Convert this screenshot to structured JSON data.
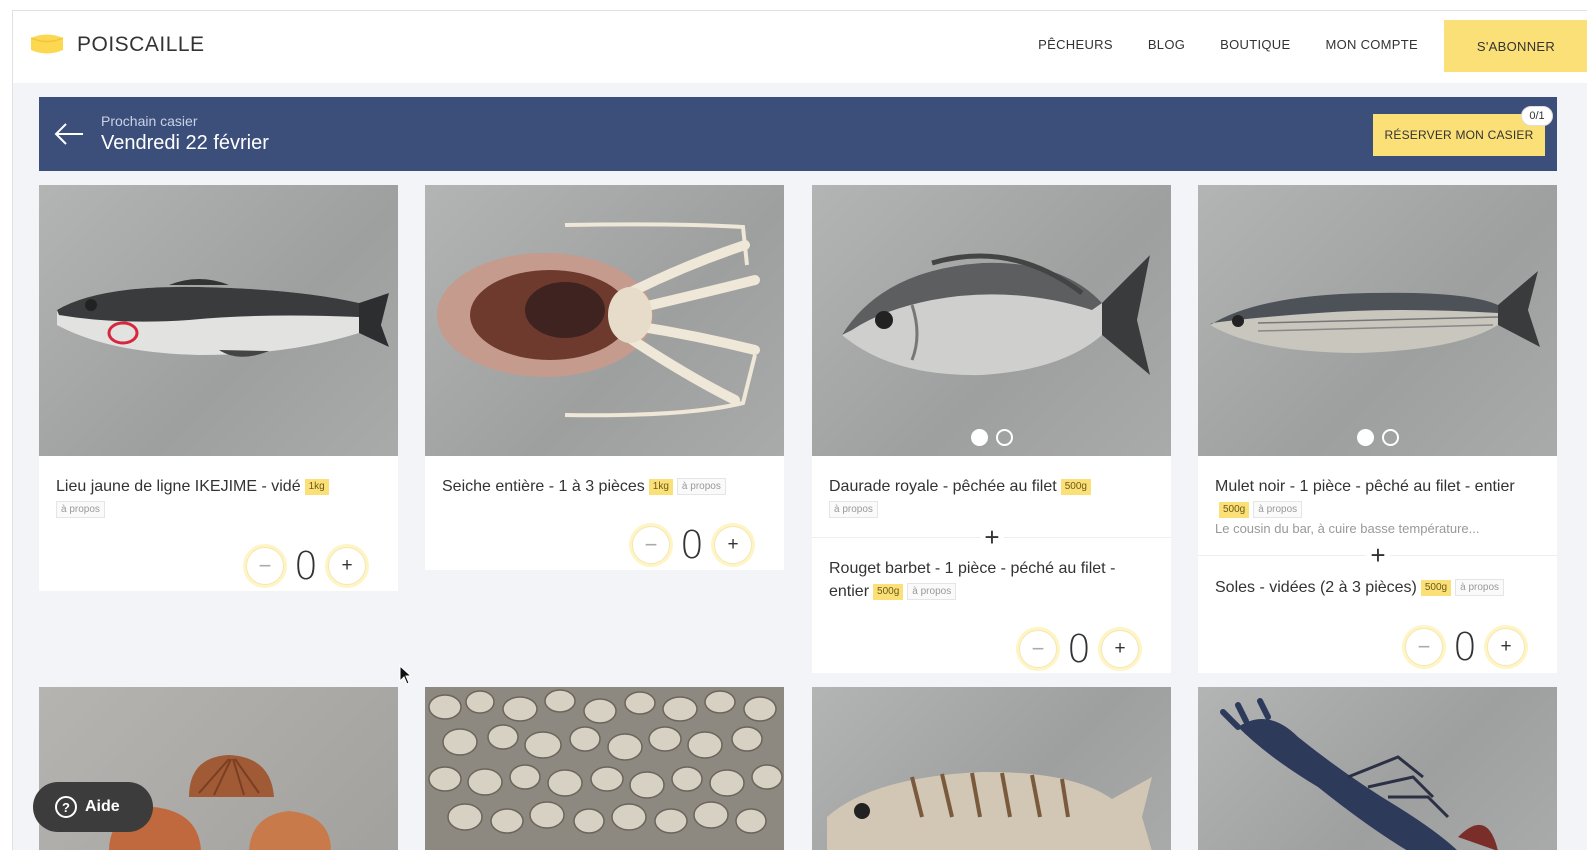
{
  "nav": {
    "brand": "POISCAILLE",
    "links": [
      "PÊCHEURS",
      "BLOG",
      "BOUTIQUE",
      "MON COMPTE"
    ],
    "cta": "S'ABONNER",
    "colors": {
      "accent": "#fbe077",
      "navy": "#3c4f7b"
    }
  },
  "banner": {
    "subtitle": "Prochain casier",
    "title": "Vendredi 22 février",
    "reserve_label": "RÉSERVER MON CASIER",
    "reserve_badge": "0/1"
  },
  "cards": [
    {
      "items": [
        {
          "title": "Lieu jaune de ligne IKEJIME - vidé",
          "weight": "1kg",
          "link": "à propos"
        }
      ],
      "quantity": "0",
      "image_icon": "pollock-fish-icon"
    },
    {
      "items": [
        {
          "title": "Seiche entière - 1 à 3 pièces",
          "weight": "1kg",
          "link": "à propos"
        }
      ],
      "quantity": "0",
      "image_icon": "cuttlefish-icon"
    },
    {
      "items": [
        {
          "title": "Daurade royale - pêchée au filet",
          "weight": "500g",
          "link": "à propos"
        },
        {
          "title": "Rouget barbet - 1 pièce - péché au filet - entier",
          "weight": "500g",
          "link": "à propos"
        }
      ],
      "quantity": "0",
      "image_icon": "sea-bream-icon"
    },
    {
      "items": [
        {
          "title": "Mulet noir - 1 pièce - pêché au filet - entier",
          "weight": "500g",
          "link": "à propos",
          "description": "Le cousin du bar, à cuire basse température..."
        },
        {
          "title": "Soles - vidées (2 à 3 pièces)",
          "weight": "500g",
          "link": "à propos"
        }
      ],
      "quantity": "0",
      "image_icon": "mullet-fish-icon"
    }
  ],
  "second_row_icons": [
    "scallops-icon",
    "clams-icon",
    "sea-bream-icon",
    "lobster-icon"
  ],
  "help": {
    "label": "Aide"
  },
  "separator_symbol": "+"
}
